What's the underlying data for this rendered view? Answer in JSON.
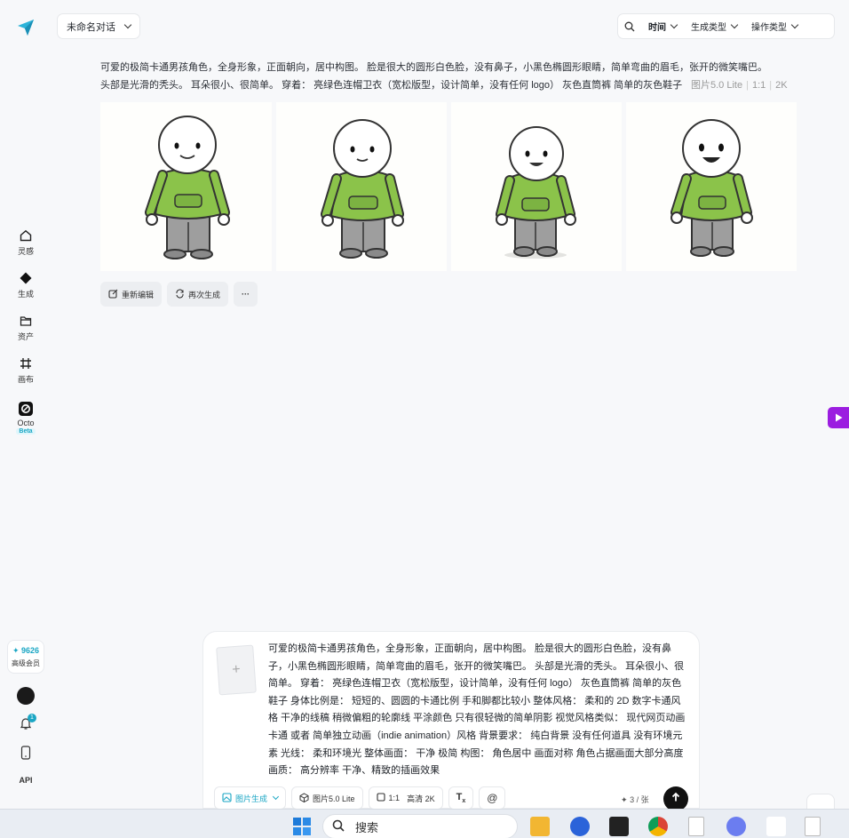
{
  "sidebar": {
    "items": [
      {
        "label": "灵感",
        "icon": "home-icon"
      },
      {
        "label": "生成",
        "icon": "diamond-icon"
      },
      {
        "label": "资产",
        "icon": "folder-icon"
      },
      {
        "label": "画布",
        "icon": "canvas-icon"
      },
      {
        "label": "Octo",
        "icon": "octo-icon",
        "badge": "Beta"
      }
    ],
    "member": {
      "points": "✦ 9626",
      "label": "高级会员"
    },
    "notification_count": "1",
    "api_label": "API"
  },
  "header": {
    "conversation_title": "未命名对话",
    "filters": [
      "时间",
      "生成类型",
      "操作类型"
    ]
  },
  "prompt": {
    "line1": "可爱的极简卡通男孩角色，全身形象，正面朝向，居中构图。 脸是很大的圆形白色脸，没有鼻子，小黑色椭圆形眼睛，简单弯曲的眉毛，张开的微笑嘴巴。",
    "line2": "头部是光滑的秃头。 耳朵很小、很简单。 穿着： 亮绿色连帽卫衣（宽松版型，设计简单，没有任何 logo） 灰色直筒裤 简单的灰色鞋子",
    "model": "图片5.0 Lite",
    "ratio": "1:1",
    "resolution": "2K"
  },
  "actions": {
    "reedit": "重新编辑",
    "regenerate": "再次生成",
    "more": "···"
  },
  "composer": {
    "text": "可爱的极简卡通男孩角色，全身形象，正面朝向，居中构图。 脸是很大的圆形白色脸，没有鼻子，小黑色椭圆形眼睛，简单弯曲的眉毛，张开的微笑嘴巴。 头部是光滑的秃头。 耳朵很小、很简单。 穿着： 亮绿色连帽卫衣（宽松版型，设计简单，没有任何 logo） 灰色直筒裤 简单的灰色鞋子 身体比例是： 短短的、圆圆的卡通比例 手和脚都比较小 整体风格： 柔和的 2D 数字卡通风格 干净的线稿 稍微偏粗的轮廓线 平涂颜色 只有很轻微的简单阴影 视觉风格类似： 现代网页动画卡通 或者 简单独立动画（indie animation）风格 背景要求： 纯白背景 没有任何道具 没有环境元素 光线： 柔和环境光 整体画面： 干净 极简 构图： 角色居中 画面对称 角色占据画面大部分高度 画质： 高分辨率 干净、精致的插画效果",
    "mode": "图片生成",
    "model": "图片5.0 Lite",
    "ratio": "1:1",
    "quality": "高清 2K",
    "quota": "3 / 张",
    "mention": "@",
    "plus": "+"
  },
  "taskbar": {
    "search_label": "搜索"
  },
  "colors": {
    "accent": "#1aa6c4",
    "hoodie": "#8bc34a",
    "pants": "#9e9e9e"
  }
}
